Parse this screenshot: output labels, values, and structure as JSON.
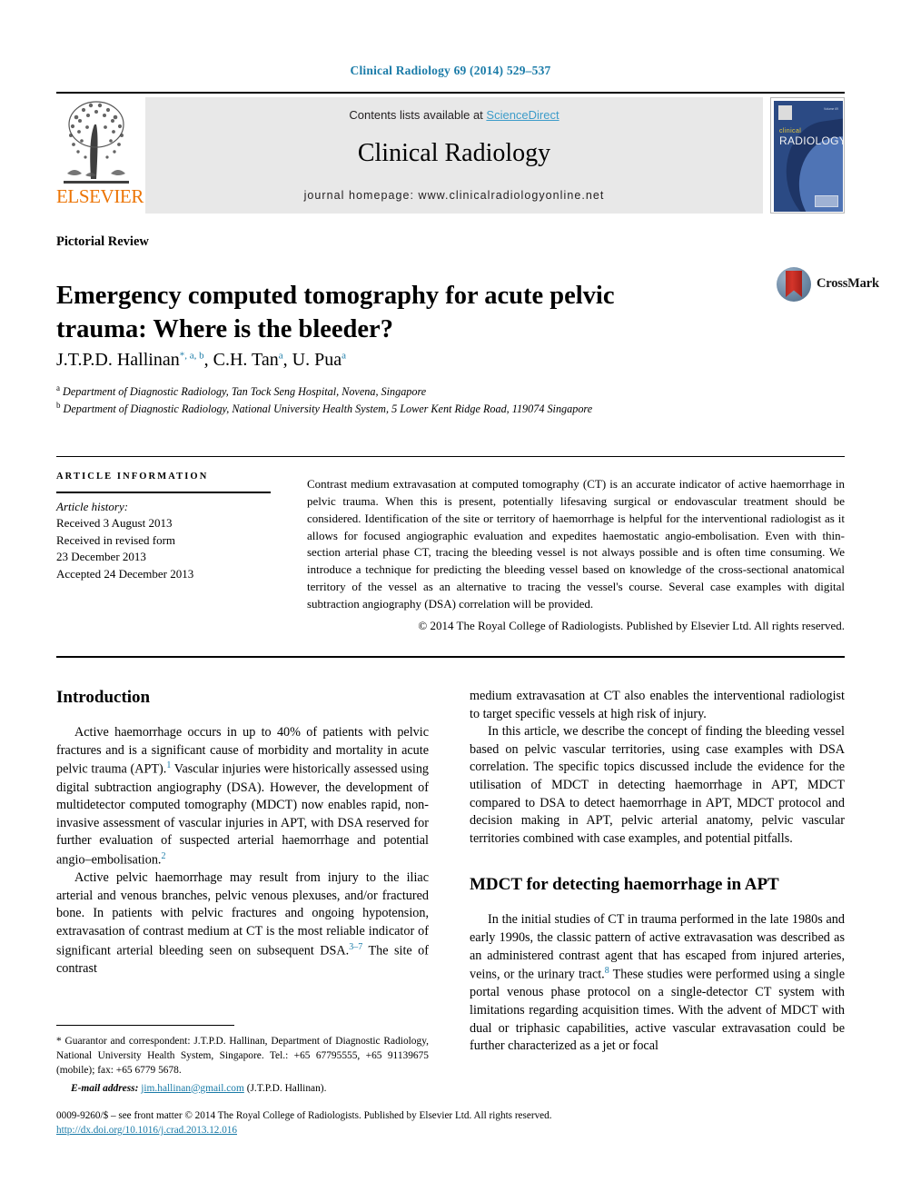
{
  "running_head": "Clinical Radiology 69 (2014) 529–537",
  "masthead": {
    "publisher_name": "ELSEVIER",
    "contents_prefix": "Contents lists available at ",
    "contents_link": "ScienceDirect",
    "journal_name": "Clinical Radiology",
    "homepage": "journal homepage: www.clinicalradiologyonline.net",
    "cover": {
      "title_small": "clinical",
      "title_large": "RADIOLOGY",
      "corner_label": "Volume 69"
    }
  },
  "article": {
    "type": "Pictorial Review",
    "title": "Emergency computed tomography for acute pelvic trauma: Where is the bleeder?",
    "crossmark_label": "CrossMark",
    "authors_html": "J.T.P.D. Hallinan<span class=\"sup\">*, a, b</span>, C.H. Tan<span class=\"sup\">a</span>, U. Pua<span class=\"sup\">a</span>",
    "affiliation_a": "Department of Diagnostic Radiology, Tan Tock Seng Hospital, Novena, Singapore",
    "affiliation_b": "Department of Diagnostic Radiology, National University Health System, 5 Lower Kent Ridge Road, 119074 Singapore"
  },
  "info": {
    "heading": "ARTICLE INFORMATION",
    "history_label": "Article history:",
    "received": "Received 3 August 2013",
    "revised_label": "Received in revised form",
    "revised_date": "23 December 2013",
    "accepted": "Accepted 24 December 2013"
  },
  "abstract": {
    "text": "Contrast medium extravasation at computed tomography (CT) is an accurate indicator of active haemorrhage in pelvic trauma. When this is present, potentially lifesaving surgical or endovascular treatment should be considered. Identification of the site or territory of haemorrhage is helpful for the interventional radiologist as it allows for focused angiographic evaluation and expedites haemostatic angio-embolisation. Even with thin-section arterial phase CT, tracing the bleeding vessel is not always possible and is often time consuming. We introduce a technique for predicting the bleeding vessel based on knowledge of the cross-sectional anatomical territory of the vessel as an alternative to tracing the vessel's course. Several case examples with digital subtraction angiography (DSA) correlation will be provided.",
    "copyright": "© 2014 The Royal College of Radiologists. Published by Elsevier Ltd. All rights reserved."
  },
  "body": {
    "intro_heading": "Introduction",
    "intro_p1_a": "Active haemorrhage occurs in up to 40% of patients with pelvic fractures and is a significant cause of morbidity and mortality in acute pelvic trauma (APT).",
    "intro_p1_ref1": "1",
    "intro_p1_b": " Vascular injuries were historically assessed using digital subtraction angiography (DSA). However, the development of multidetector computed tomography (MDCT) now enables rapid, non-invasive assessment of vascular injuries in APT, with DSA reserved for further evaluation of suspected arterial haemorrhage and potential angio–embolisation.",
    "intro_p1_ref2": "2",
    "intro_p2_a": "Active pelvic haemorrhage may result from injury to the iliac arterial and venous branches, pelvic venous plexuses, and/or fractured bone. In patients with pelvic fractures and ongoing hypotension, extravasation of contrast medium at CT is the most reliable indicator of significant arterial bleeding seen on subsequent DSA.",
    "intro_p2_ref": "3–7",
    "intro_p2_b": " The site of contrast",
    "right_p1": "medium extravasation at CT also enables the interventional radiologist to target specific vessels at high risk of injury.",
    "right_p2": "In this article, we describe the concept of finding the bleeding vessel based on pelvic vascular territories, using case examples with DSA correlation. The specific topics discussed include the evidence for the utilisation of MDCT in detecting haemorrhage in APT, MDCT compared to DSA to detect haemorrhage in APT, MDCT protocol and decision making in APT, pelvic arterial anatomy, pelvic vascular territories combined with case examples, and potential pitfalls.",
    "mdct_heading": "MDCT for detecting haemorrhage in APT",
    "mdct_p1_a": "In the initial studies of CT in trauma performed in the late 1980s and early 1990s, the classic pattern of active extravasation was described as an administered contrast agent that has escaped from injured arteries, veins, or the urinary tract.",
    "mdct_p1_ref": "8",
    "mdct_p1_b": " These studies were performed using a single portal venous phase protocol on a single-detector CT system with limitations regarding acquisition times. With the advent of MDCT with dual or triphasic capabilities, active vascular extravasation could be further characterized as a jet or focal"
  },
  "footnotes": {
    "correspondence": "* Guarantor and correspondent: J.T.P.D. Hallinan, Department of Diagnostic Radiology, National University Health System, Singapore. Tel.: +65 67795555, +65 91139675 (mobile); fax: +65 6779 5678.",
    "email_label": "E-mail address:",
    "email": "jim.hallinan@gmail.com",
    "email_suffix": " (J.T.P.D. Hallinan).",
    "issn": "0009-9260/$ – see front matter © 2014 The Royal College of Radiologists. Published by Elsevier Ltd. All rights reserved.",
    "doi": "http://dx.doi.org/10.1016/j.crad.2013.12.016"
  },
  "colors": {
    "link_blue": "#1a7ba8",
    "sciencedirect_blue": "#3d9cc9",
    "elsevier_orange": "#ec7404",
    "band_grey": "#e8e8e8"
  }
}
